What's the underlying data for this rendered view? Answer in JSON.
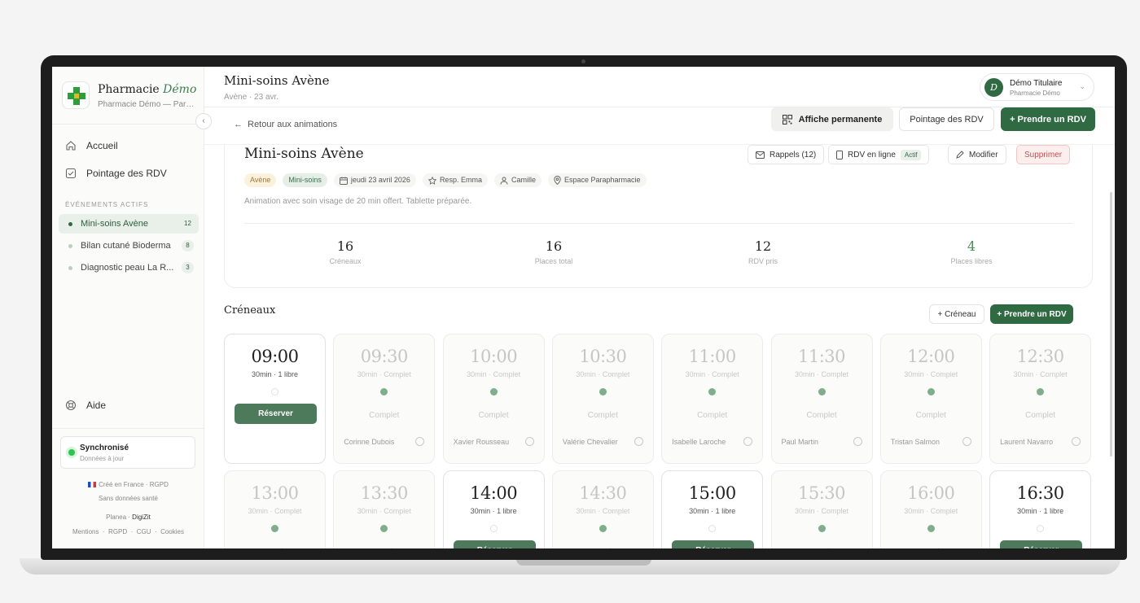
{
  "brand": {
    "name": "Pharmacie ",
    "name_accent": "Démo",
    "sub": "Pharmacie Démo — Parapharmacie"
  },
  "nav": {
    "home": "Accueil",
    "checkin": "Pointage des RDV",
    "help": "Aide"
  },
  "sidebar": {
    "section_label": "ÉVÉNEMENTS ACTIFS",
    "events": [
      {
        "label": "Mini-soins Avène",
        "count": "12"
      },
      {
        "label": "Bilan cutané Bioderma",
        "count": "8"
      },
      {
        "label": "Diagnostic peau La R...",
        "count": "3"
      }
    ],
    "sync_title": "Synchronisé",
    "sync_sub": "Données à jour",
    "footer": {
      "made": "Créé en France",
      "sep1": " · ",
      "rgpd": "RGPD",
      "health": "Sans données santé",
      "planea": "Planea · ",
      "digizit": "DigiZit",
      "links": [
        "Mentions",
        "RGPD",
        "CGU",
        "Cookies"
      ]
    }
  },
  "header": {
    "title": "Mini-soins Avène",
    "subtitle": "Avène · 23 avr."
  },
  "user": {
    "initial": "D",
    "name": "Démo Titulaire",
    "org": "Pharmacie Démo"
  },
  "actions": {
    "back": "Retour aux animations",
    "poster": "Affiche permanente",
    "checkin": "Pointage des RDV",
    "book": "+ Prendre un RDV"
  },
  "event": {
    "title": "Mini-soins Avène",
    "reminders": "Rappels (12)",
    "online": "RDV en ligne",
    "online_status": "Actif",
    "edit": "Modifier",
    "delete": "Supprimer",
    "tags": {
      "brand": "Avène",
      "type": "Mini-soins",
      "date": "jeudi 23 avril 2026",
      "resp": "Resp. Emma",
      "staff": "Camille",
      "place": "Espace Parapharmacie"
    },
    "description": "Animation avec soin visage de 20 min offert. Tablette préparée.",
    "stats": [
      {
        "value": "16",
        "label": "Créneaux"
      },
      {
        "value": "16",
        "label": "Places total"
      },
      {
        "value": "12",
        "label": "RDV pris"
      },
      {
        "value": "4",
        "label": "Places libres"
      }
    ]
  },
  "slots_section": {
    "title": "Créneaux",
    "add": "+ Créneau",
    "book": "+ Prendre un RDV",
    "reserve_label": "Réserver",
    "complete_label": "Complet"
  },
  "slots": [
    {
      "time": "09:00",
      "info": "30min · 1 libre",
      "free": true,
      "person": ""
    },
    {
      "time": "09:30",
      "info": "30min · Complet",
      "free": false,
      "person": "Corinne Dubois"
    },
    {
      "time": "10:00",
      "info": "30min · Complet",
      "free": false,
      "person": "Xavier Rousseau"
    },
    {
      "time": "10:30",
      "info": "30min · Complet",
      "free": false,
      "person": "Valérie Chevalier"
    },
    {
      "time": "11:00",
      "info": "30min · Complet",
      "free": false,
      "person": "Isabelle Laroche"
    },
    {
      "time": "11:30",
      "info": "30min · Complet",
      "free": false,
      "person": "Paul Martin"
    },
    {
      "time": "12:00",
      "info": "30min · Complet",
      "free": false,
      "person": "Tristan Salmon"
    },
    {
      "time": "12:30",
      "info": "30min · Complet",
      "free": false,
      "person": "Laurent Navarro"
    },
    {
      "time": "13:00",
      "info": "30min · Complet",
      "free": false,
      "person": ""
    },
    {
      "time": "13:30",
      "info": "30min · Complet",
      "free": false,
      "person": ""
    },
    {
      "time": "14:00",
      "info": "30min · 1 libre",
      "free": true,
      "person": ""
    },
    {
      "time": "14:30",
      "info": "30min · Complet",
      "free": false,
      "person": ""
    },
    {
      "time": "15:00",
      "info": "30min · 1 libre",
      "free": true,
      "person": ""
    },
    {
      "time": "15:30",
      "info": "30min · Complet",
      "free": false,
      "person": ""
    },
    {
      "time": "16:00",
      "info": "30min · Complet",
      "free": false,
      "person": ""
    },
    {
      "time": "16:30",
      "info": "30min · 1 libre",
      "free": true,
      "person": ""
    }
  ],
  "colors": {
    "accent": "#2f6a42",
    "sync": "#2ec250",
    "danger": "#c0504f"
  }
}
